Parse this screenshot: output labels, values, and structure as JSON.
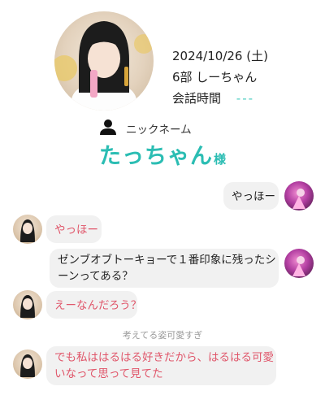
{
  "header": {
    "date": "2024/10/26 (土)",
    "session": "6部  しーちゃん",
    "talk_time_label": "会話時間",
    "talk_time_value": "---"
  },
  "nickname": {
    "label": "ニックネーム",
    "name": "たっちゃん",
    "honorific": "様"
  },
  "messages": [
    {
      "side": "right",
      "text": "やっほー"
    },
    {
      "side": "left",
      "text": "やっほー"
    },
    {
      "side": "right",
      "line1": "ゼンブオブトーキョーで１番印象に残ったシ",
      "line2": "ーンってある？"
    },
    {
      "side": "left",
      "text": "えーなんだろう？"
    },
    {
      "side": "left",
      "line1": "でも私ははるはる好きだから、はるはる可愛",
      "line2": "いなって思って見てた"
    }
  ],
  "note": "考えてる姿可愛すぎ",
  "colors": {
    "accent": "#2bbdb3",
    "idol_text": "#e0566a",
    "bubble": "#f1f1f1"
  }
}
